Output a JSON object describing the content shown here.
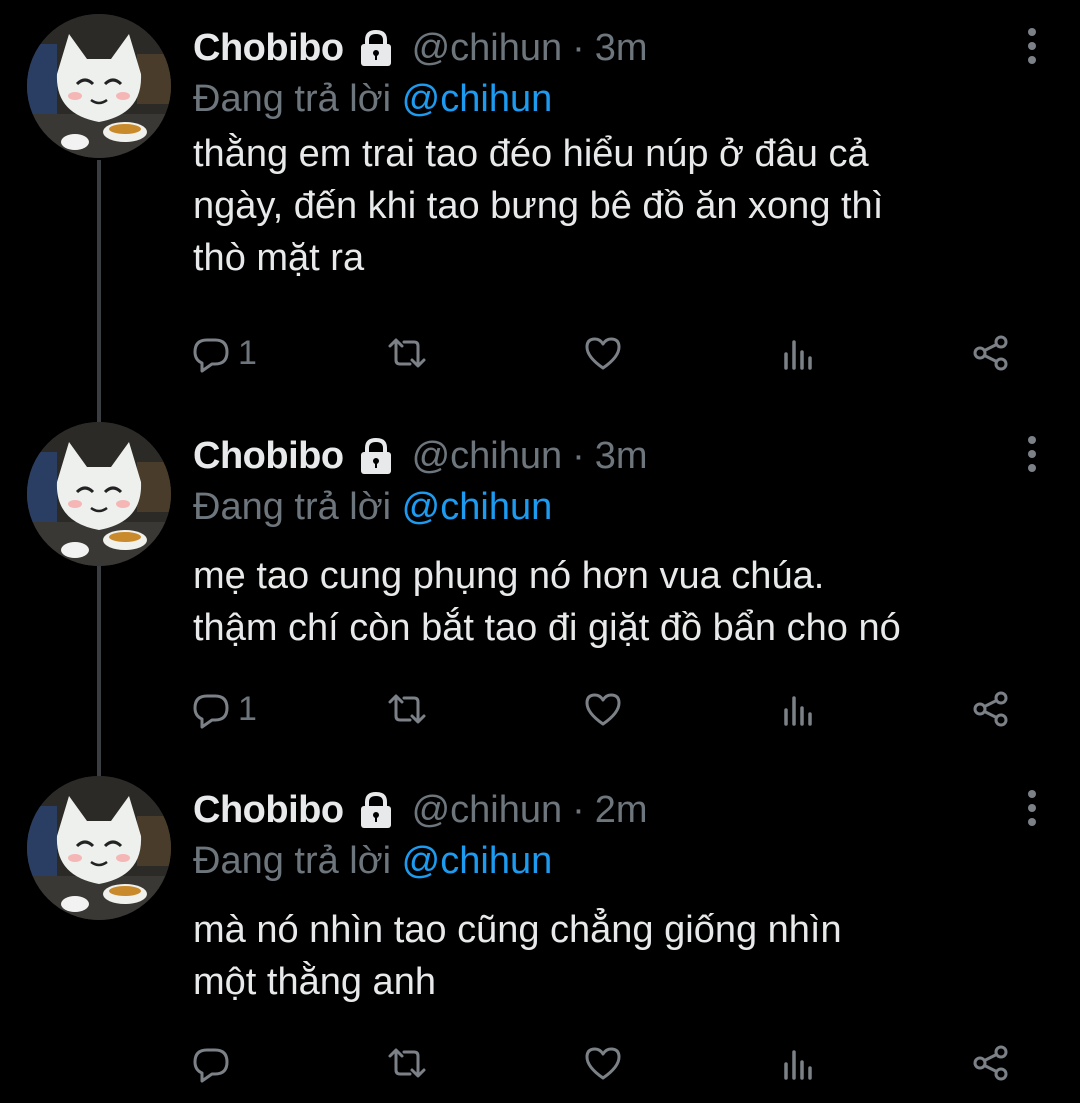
{
  "tweets": [
    {
      "name": "Chobibo",
      "handle": "@chihun",
      "separator": "·",
      "time": "3m",
      "reply_prefix": "Đang trả lời",
      "reply_to": "@chihun",
      "lines": [
        "thằng em trai tao đéo hiểu núp ở đâu cả",
        "ngày, đến khi tao bưng bê đồ ăn xong thì",
        "thò mặt ra"
      ],
      "reply_count": "1"
    },
    {
      "name": "Chobibo",
      "handle": "@chihun",
      "separator": "·",
      "time": "3m",
      "reply_prefix": "Đang trả lời",
      "reply_to": "@chihun",
      "lines": [
        "mẹ tao cung phụng nó hơn vua chúa.",
        "thậm chí còn bắt tao đi giặt đồ bẩn cho nó"
      ],
      "reply_count": "1"
    },
    {
      "name": "Chobibo",
      "handle": "@chihun",
      "separator": "·",
      "time": "2m",
      "reply_prefix": "Đang trả lời",
      "reply_to": "@chihun",
      "lines": [
        "mà nó nhìn tao cũng chẳng giống nhìn",
        "một thằng anh"
      ],
      "reply_count": ""
    }
  ],
  "icons": {
    "lock": "lock-icon",
    "reply": "reply-icon",
    "retweet": "retweet-icon",
    "like": "like-icon",
    "analytics": "analytics-icon",
    "share": "share-icon",
    "more": "more-icon"
  },
  "colors": {
    "background": "#000000",
    "text": "#e7e9ea",
    "secondary": "#6e767d",
    "link": "#1d9bf0",
    "thread_line": "#3a3d41"
  }
}
